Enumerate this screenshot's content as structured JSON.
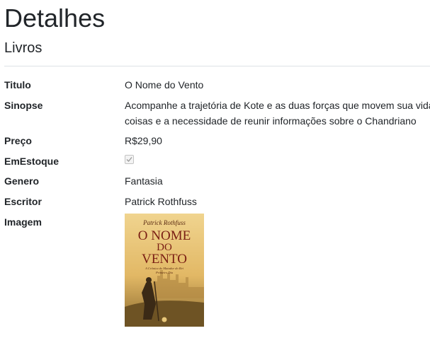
{
  "header": {
    "title": "Detalhes",
    "section": "Livros"
  },
  "details": {
    "titulo": {
      "label": "Titulo",
      "value": "O Nome do Vento"
    },
    "sinopse": {
      "label": "Sinopse",
      "line1": "Acompanhe a trajetória de Kote e as duas forças que movem sua vida:",
      "line2": "coisas e a necessidade de reunir informações sobre o Chandriano"
    },
    "preco": {
      "label": "Preço",
      "value": "R$29,90"
    },
    "emestoque": {
      "label": "EmEstoque",
      "checked": true
    },
    "genero": {
      "label": "Genero",
      "value": "Fantasia"
    },
    "escritor": {
      "label": "Escritor",
      "value": "Patrick Rothfuss"
    },
    "imagem": {
      "label": "Imagem",
      "cover": {
        "author": "Patrick Rothfuss",
        "title_line1": "O NOME",
        "title_line2": "DO",
        "title_line3": "VENTO",
        "subtitle": "A Crônica do Matador do Rei",
        "subtitle2": "Primeiro Dia"
      }
    }
  },
  "colors": {
    "text": "#212529",
    "divider": "#dee2e6",
    "cover_sky": "#e8c77a",
    "cover_ground": "#8a6a2e",
    "cover_title": "#7a1e14"
  }
}
